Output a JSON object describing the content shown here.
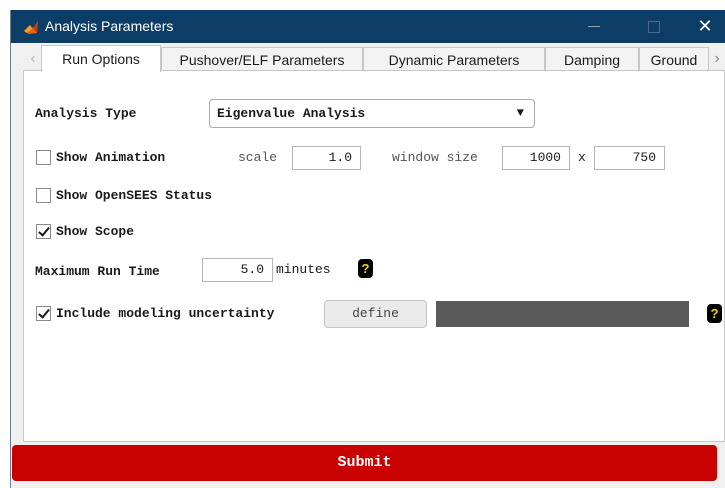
{
  "window": {
    "title": "Analysis Parameters",
    "minimize_glyph": "—",
    "close_glyph": "✕",
    "icon": "matlab-logo-icon"
  },
  "tabs": [
    {
      "label": "Run Options",
      "active": true
    },
    {
      "label": "Pushover/ELF Parameters",
      "active": false
    },
    {
      "label": "Dynamic Parameters",
      "active": false
    },
    {
      "label": "Damping",
      "active": false
    },
    {
      "label": "Ground",
      "active": false
    }
  ],
  "tab_nav": {
    "prev": "‹",
    "next": "›"
  },
  "analysis_type": {
    "label": "Analysis Type",
    "selected": "Eigenvalue Analysis",
    "arrow": "▼"
  },
  "animation": {
    "label": "Show Animation",
    "checked": false,
    "scale_label": "scale",
    "scale_value": "1.0",
    "window_size_label": "window size",
    "width_value": "1000",
    "times": "x",
    "height_value": "750"
  },
  "opensees_status": {
    "label": "Show OpenSEES Status",
    "checked": false
  },
  "scope": {
    "label": "Show Scope",
    "checked": true
  },
  "run_time": {
    "label": "Maximum Run Time",
    "value": "5.0",
    "unit": "minutes",
    "help": "?"
  },
  "uncertainty": {
    "label": "Include modeling uncertainty",
    "checked": true,
    "define_label": "define",
    "help": "?"
  },
  "submit_label": "Submit",
  "colors": {
    "titlebar": "#0c3d66",
    "submit": "#c80000",
    "help_bg": "#000000",
    "help_fg": "#f2d300",
    "dark_bar": "#5a5a5a"
  }
}
